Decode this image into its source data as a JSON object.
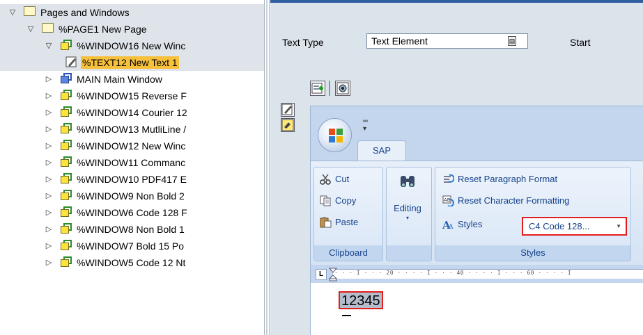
{
  "tree": {
    "rows": [
      {
        "label": "Pages and Windows",
        "indent": 0,
        "toggle": "▽",
        "icon": "folder",
        "band": true,
        "selected": false
      },
      {
        "label": "%PAGE1 New Page",
        "indent": 1,
        "toggle": "▽",
        "icon": "folder",
        "band": true,
        "selected": false
      },
      {
        "label": "%WINDOW16 New Winc",
        "indent": 2,
        "toggle": "▽",
        "icon": "window",
        "band": true,
        "selected": false
      },
      {
        "label": "%TEXT12 New Text 1",
        "indent": 3,
        "toggle": "",
        "icon": "text",
        "band": true,
        "selected": true
      },
      {
        "label": "MAIN Main Window",
        "indent": 2,
        "toggle": "▷",
        "icon": "main-window",
        "band": false,
        "selected": false
      },
      {
        "label": "%WINDOW15 Reverse F",
        "indent": 2,
        "toggle": "▷",
        "icon": "window",
        "band": false,
        "selected": false
      },
      {
        "label": "%WINDOW14 Courier 12",
        "indent": 2,
        "toggle": "▷",
        "icon": "window",
        "band": false,
        "selected": false
      },
      {
        "label": "%WINDOW13 MutliLine /",
        "indent": 2,
        "toggle": "▷",
        "icon": "window",
        "band": false,
        "selected": false
      },
      {
        "label": "%WINDOW12 New Winc",
        "indent": 2,
        "toggle": "▷",
        "icon": "window",
        "band": false,
        "selected": false
      },
      {
        "label": "%WINDOW11 Commanc",
        "indent": 2,
        "toggle": "▷",
        "icon": "window",
        "band": false,
        "selected": false
      },
      {
        "label": "%WINDOW10 PDF417 E",
        "indent": 2,
        "toggle": "▷",
        "icon": "window",
        "band": false,
        "selected": false
      },
      {
        "label": "%WINDOW9 Non Bold 2",
        "indent": 2,
        "toggle": "▷",
        "icon": "window",
        "band": false,
        "selected": false
      },
      {
        "label": "%WINDOW6 Code 128 F",
        "indent": 2,
        "toggle": "▷",
        "icon": "window",
        "band": false,
        "selected": false
      },
      {
        "label": "%WINDOW8 Non Bold 1",
        "indent": 2,
        "toggle": "▷",
        "icon": "window",
        "band": false,
        "selected": false
      },
      {
        "label": "%WINDOW7 Bold 15 Po",
        "indent": 2,
        "toggle": "▷",
        "icon": "window",
        "band": false,
        "selected": false
      },
      {
        "label": "%WINDOW5 Code 12 Nt",
        "indent": 2,
        "toggle": "▷",
        "icon": "window",
        "band": false,
        "selected": false
      }
    ]
  },
  "form": {
    "text_type_label": "Text Type",
    "text_type_value": "Text Element",
    "start_label": "Start"
  },
  "word": {
    "tab_label": "SAP",
    "clipboard": {
      "cut": "Cut",
      "copy": "Copy",
      "paste": "Paste",
      "title": "Clipboard"
    },
    "editing_label": "Editing",
    "styles": {
      "reset_paragraph": "Reset Paragraph Format",
      "reset_character": "Reset Character Formatting",
      "styles_label": "Styles",
      "selected_style": "C4 Code 128...",
      "title": "Styles"
    },
    "ruler_ticks": "· · · I · · · 20 · · · · I · · · 40 · · · · I · · · 60 · · · · I",
    "document_text": "12345"
  },
  "colors": {
    "selection": "#f7c03b",
    "highlight_border": "#e21d1d",
    "ribbon_text": "#15428b"
  }
}
